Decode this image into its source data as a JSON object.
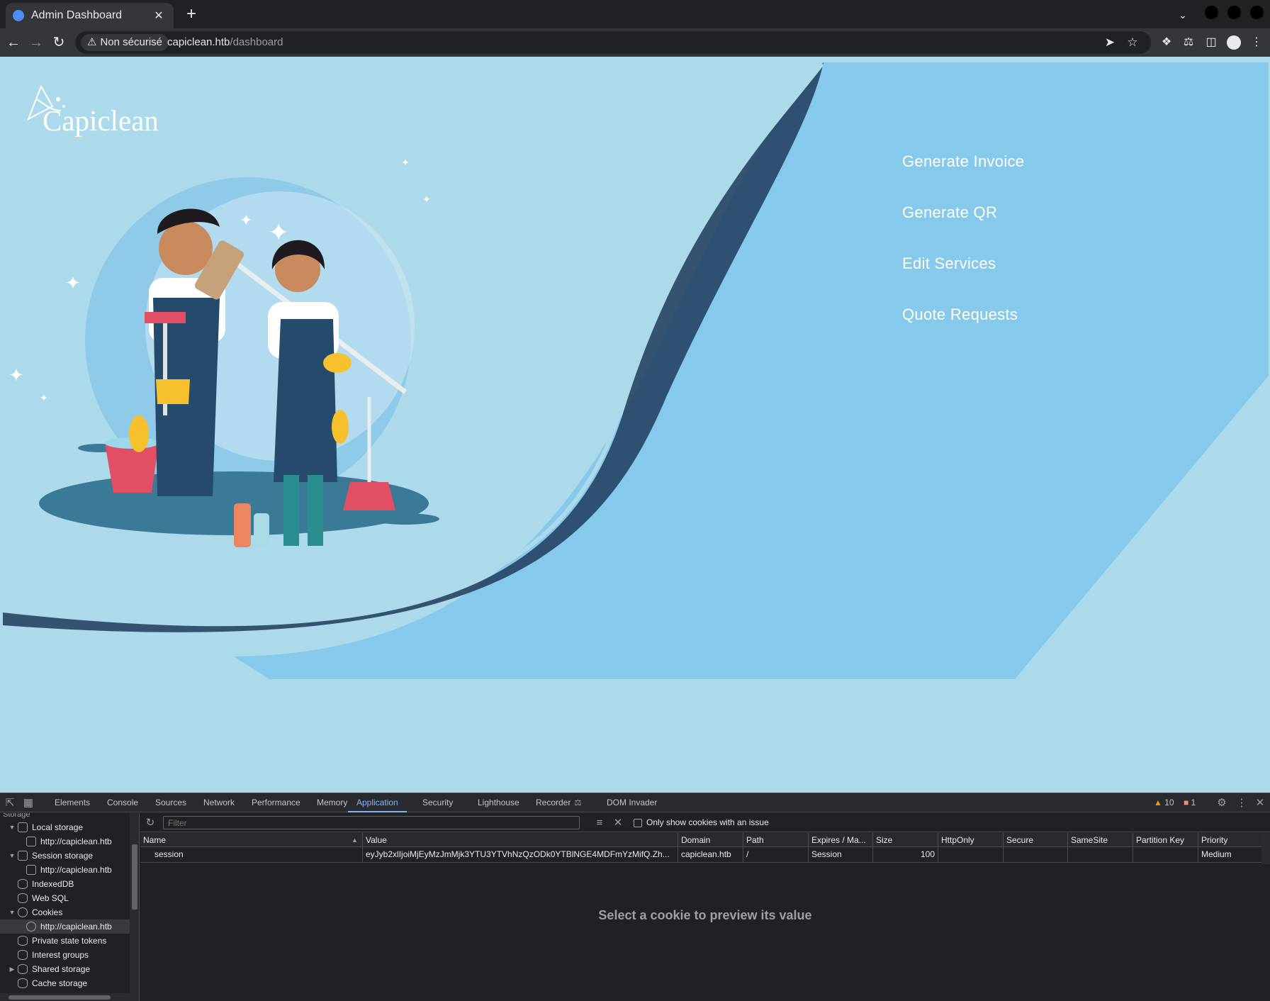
{
  "browser": {
    "tab": {
      "title": "Admin Dashboard",
      "close": "✕"
    },
    "new_tab": "+",
    "address": {
      "security_label": "Non sécurisé",
      "host": "capiclean.htb",
      "path": "/dashboard"
    }
  },
  "page": {
    "logo_text": "Capiclean",
    "menu": [
      "Generate Invoice",
      "Generate QR",
      "Edit Services",
      "Quote Requests"
    ],
    "colors": {
      "background": "#acdaeb",
      "panel": "#87c9ea",
      "shadow": "#1f3b5c",
      "text": "#ffffff"
    }
  },
  "devtools": {
    "tabs": [
      "Elements",
      "Console",
      "Sources",
      "Network",
      "Performance",
      "Memory",
      "Application",
      "Security",
      "Lighthouse",
      "Recorder",
      "DOM Invader"
    ],
    "active_tab": "Application",
    "warnings": "10",
    "errors": "1",
    "sidebar": {
      "section_label": "Storage",
      "items": [
        {
          "label": "Local storage",
          "expanded": true
        },
        {
          "label": "http://capiclean.htb"
        },
        {
          "label": "Session storage",
          "expanded": true
        },
        {
          "label": "http://capiclean.htb"
        },
        {
          "label": "IndexedDB"
        },
        {
          "label": "Web SQL"
        },
        {
          "label": "Cookies",
          "expanded": true
        },
        {
          "label": "http://capiclean.htb",
          "selected": true
        },
        {
          "label": "Private state tokens"
        },
        {
          "label": "Interest groups"
        },
        {
          "label": "Shared storage",
          "expanded": false
        },
        {
          "label": "Cache storage"
        }
      ]
    },
    "cookies": {
      "filter_placeholder": "Filter",
      "only_issues_label": "Only show cookies with an issue",
      "columns": [
        "Name",
        "Value",
        "Domain",
        "Path",
        "Expires / Ma...",
        "Size",
        "HttpOnly",
        "Secure",
        "SameSite",
        "Partition Key",
        "Priority"
      ],
      "rows": [
        [
          "session",
          "eyJyb2xlIjoiMjEyMzJmMjk3YTU3YTVhNzQzODk0YTBlNGE4MDFmYzMifQ.Zh...",
          "capiclean.htb",
          "/",
          "Session",
          "100",
          "",
          "",
          "",
          "",
          "Medium"
        ]
      ],
      "preview_text": "Select a cookie to preview its value"
    }
  }
}
